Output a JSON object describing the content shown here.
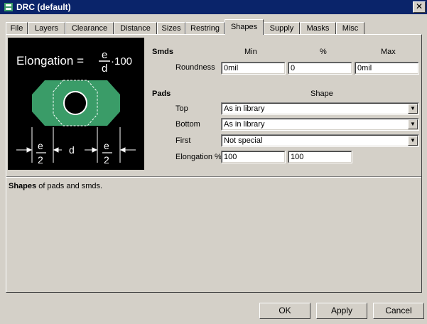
{
  "window": {
    "title": "DRC (default)",
    "close_glyph": "✕"
  },
  "tabs": [
    {
      "label": "File"
    },
    {
      "label": "Layers"
    },
    {
      "label": "Clearance"
    },
    {
      "label": "Distance"
    },
    {
      "label": "Sizes"
    },
    {
      "label": "Restring"
    },
    {
      "label": "Shapes"
    },
    {
      "label": "Supply"
    },
    {
      "label": "Masks"
    },
    {
      "label": "Misc"
    }
  ],
  "active_tab": "Shapes",
  "diagram": {
    "formula": "Elongation = ",
    "frac_num": "e",
    "frac_den": "d",
    "formula_tail": "·100",
    "dim_e_num": "e",
    "dim_e_den": "2",
    "dim_d": "d",
    "pad_color": "#3a9c68"
  },
  "smds": {
    "section_label": "Smds",
    "col_min": "Min",
    "col_percent": "%",
    "col_max": "Max",
    "roundness_label": "Roundness",
    "roundness_min": "0mil",
    "roundness_percent": "0",
    "roundness_max": "0mil"
  },
  "pads": {
    "section_label": "Pads",
    "col_shape": "Shape",
    "top_label": "Top",
    "top_value": "As in library",
    "bottom_label": "Bottom",
    "bottom_value": "As in library",
    "first_label": "First",
    "first_value": "Not special",
    "elongation_label": "Elongation %",
    "elongation_1": "100",
    "elongation_2": "100"
  },
  "status": {
    "bold": "Shapes",
    "rest": " of pads and smds."
  },
  "buttons": {
    "ok": "OK",
    "apply": "Apply",
    "cancel": "Cancel"
  },
  "colors": {
    "title_bar": "#0a246a",
    "dialog_bg": "#d4d0c8"
  }
}
